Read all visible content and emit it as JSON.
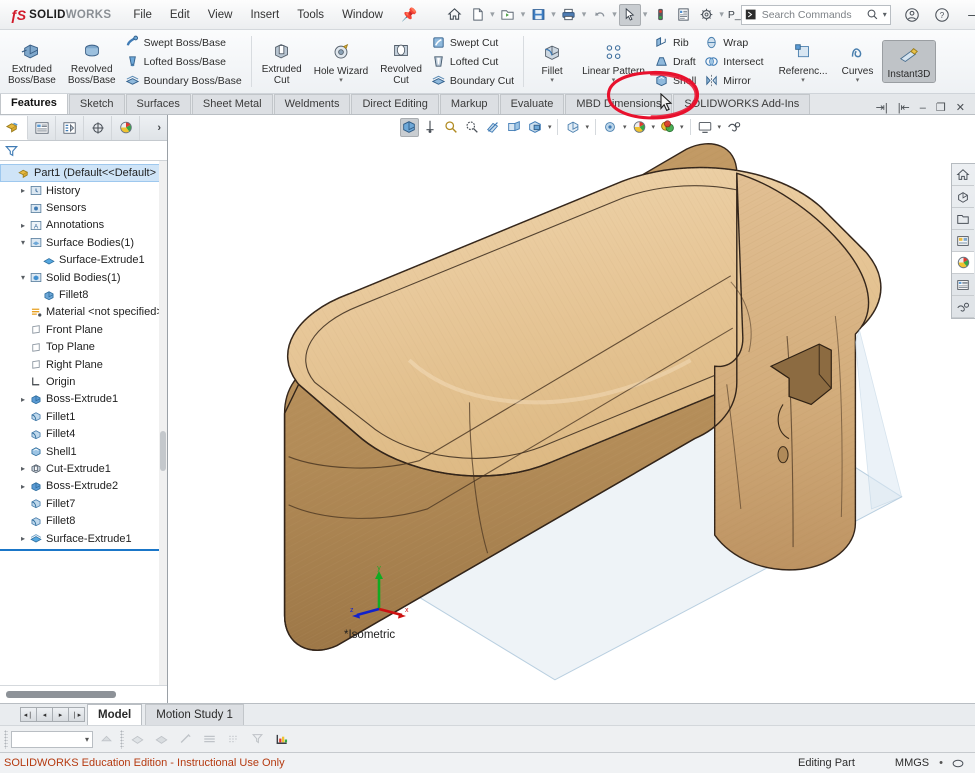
{
  "app": {
    "brand_dark": "SOLID",
    "brand_gray": "WORKS",
    "accent_red": "#d11a2a",
    "annotation_color": "#e8112d"
  },
  "menubar": {
    "items": [
      {
        "label": "File"
      },
      {
        "label": "Edit"
      },
      {
        "label": "View"
      },
      {
        "label": "Insert"
      },
      {
        "label": "Tools"
      },
      {
        "label": "Window"
      }
    ],
    "pin_icon": "pushpin-icon"
  },
  "quick_access": [
    {
      "name": "home-icon",
      "label": "Home"
    },
    {
      "name": "new-document-icon",
      "label": "New"
    },
    {
      "name": "open-folder-icon",
      "label": "Open"
    },
    {
      "name": "save-icon",
      "label": "Save"
    },
    {
      "name": "print-icon",
      "label": "Print"
    },
    {
      "name": "undo-icon",
      "label": "Undo"
    },
    {
      "name": "select-cursor-icon",
      "label": "Select"
    },
    {
      "name": "rebuild-icon",
      "label": "Rebuild"
    },
    {
      "name": "file-properties-icon",
      "label": "File Properties"
    },
    {
      "name": "options-gear-icon",
      "label": "Options"
    }
  ],
  "search": {
    "placeholder": "Search Commands",
    "icon": "search-icon",
    "dropdown_icon": "chevron-down-icon"
  },
  "window_controls": {
    "account": "account-icon",
    "help": "help-icon",
    "minimize": "minimize-icon",
    "maximize": "maximize-icon",
    "close": "close-icon"
  },
  "ribbon": {
    "boss_group": {
      "extruded": {
        "line1": "Extruded",
        "line2": "Boss/Base"
      },
      "revolved": {
        "line1": "Revolved",
        "line2": "Boss/Base"
      },
      "small": [
        {
          "label": "Swept Boss/Base",
          "icon": "swept-boss-icon"
        },
        {
          "label": "Lofted Boss/Base",
          "icon": "lofted-boss-icon"
        },
        {
          "label": "Boundary Boss/Base",
          "icon": "boundary-boss-icon"
        }
      ]
    },
    "cut_group": {
      "extruded_cut": {
        "line1": "Extruded",
        "line2": "Cut"
      },
      "hole_wizard": {
        "line1": "Hole Wizard",
        "line2": ""
      },
      "revolved_cut": {
        "line1": "Revolved",
        "line2": "Cut"
      },
      "small": [
        {
          "label": "Swept Cut",
          "icon": "swept-cut-icon"
        },
        {
          "label": "Lofted Cut",
          "icon": "lofted-cut-icon"
        },
        {
          "label": "Boundary Cut",
          "icon": "boundary-cut-icon"
        }
      ]
    },
    "feature_group": {
      "fillet": {
        "line1": "Fillet",
        "line2": ""
      },
      "linear_pattern": {
        "line1": "Linear Pattern",
        "line2": ""
      },
      "small_a": [
        {
          "label": "Rib",
          "icon": "rib-icon"
        },
        {
          "label": "Draft",
          "icon": "draft-icon"
        },
        {
          "label": "Shell",
          "icon": "shell-icon"
        }
      ],
      "small_b": [
        {
          "label": "Wrap",
          "icon": "wrap-icon"
        },
        {
          "label": "Intersect",
          "icon": "intersect-icon"
        },
        {
          "label": "Mirror",
          "icon": "mirror-icon"
        }
      ]
    },
    "right_group": {
      "reference": {
        "line1": "Referenc...",
        "line2": ""
      },
      "curves": {
        "line1": "Curves",
        "line2": ""
      },
      "instant3d": {
        "line1": "Instant3D",
        "line2": ""
      }
    },
    "annotation": {
      "target": "Intersect",
      "shape": "hand-drawn-ellipse"
    }
  },
  "ribbon_tabs": [
    {
      "label": "Features",
      "active": true
    },
    {
      "label": "Sketch",
      "active": false
    },
    {
      "label": "Surfaces",
      "active": false
    },
    {
      "label": "Sheet Metal",
      "active": false
    },
    {
      "label": "Weldments",
      "active": false
    },
    {
      "label": "Direct Editing",
      "active": false
    },
    {
      "label": "Markup",
      "active": false
    },
    {
      "label": "Evaluate",
      "active": false
    },
    {
      "label": "MBD Dimensions",
      "active": false
    },
    {
      "label": "SOLIDWORKS Add-Ins",
      "active": false
    }
  ],
  "document_window_controls": [
    {
      "name": "restore-left-icon"
    },
    {
      "name": "restore-right-icon"
    },
    {
      "name": "doc-minimize-icon"
    },
    {
      "name": "doc-restore-icon"
    },
    {
      "name": "doc-close-icon"
    }
  ],
  "manager_tabs": [
    {
      "name": "feature-manager-tab",
      "label": "FeatureManager Design Tree",
      "active": true
    },
    {
      "name": "property-manager-tab",
      "label": "PropertyManager",
      "active": false
    },
    {
      "name": "configuration-manager-tab",
      "label": "ConfigurationManager",
      "active": false
    },
    {
      "name": "dimxpert-manager-tab",
      "label": "DimXpertManager",
      "active": false
    },
    {
      "name": "display-manager-tab",
      "label": "DisplayManager",
      "active": false
    },
    {
      "name": "manager-expand",
      "label": "›",
      "active": false
    }
  ],
  "filter": {
    "icon": "filter-funnel-icon",
    "value": "",
    "placeholder": ""
  },
  "tree": {
    "items": [
      {
        "label": "Part1  (Default<<Default>",
        "indent": 0,
        "arrow": "",
        "icon": "part-icon",
        "selected": true
      },
      {
        "label": "History",
        "indent": 1,
        "arrow": "▸",
        "icon": "history-icon",
        "selected": false
      },
      {
        "label": "Sensors",
        "indent": 1,
        "arrow": "",
        "icon": "sensors-icon",
        "selected": false
      },
      {
        "label": "Annotations",
        "indent": 1,
        "arrow": "▸",
        "icon": "annotations-icon",
        "selected": false
      },
      {
        "label": "Surface Bodies(1)",
        "indent": 1,
        "arrow": "▾",
        "icon": "surface-bodies-icon",
        "selected": false
      },
      {
        "label": "Surface-Extrude1",
        "indent": 2,
        "arrow": "",
        "icon": "surface-body-icon",
        "selected": false
      },
      {
        "label": "Solid Bodies(1)",
        "indent": 1,
        "arrow": "▾",
        "icon": "solid-bodies-icon",
        "selected": false
      },
      {
        "label": "Fillet8",
        "indent": 2,
        "arrow": "",
        "icon": "solid-body-icon",
        "selected": false
      },
      {
        "label": "Material <not specified>",
        "indent": 1,
        "arrow": "",
        "icon": "material-icon",
        "selected": false
      },
      {
        "label": "Front Plane",
        "indent": 1,
        "arrow": "",
        "icon": "plane-icon",
        "selected": false
      },
      {
        "label": "Top Plane",
        "indent": 1,
        "arrow": "",
        "icon": "plane-icon",
        "selected": false
      },
      {
        "label": "Right Plane",
        "indent": 1,
        "arrow": "",
        "icon": "plane-icon",
        "selected": false
      },
      {
        "label": "Origin",
        "indent": 1,
        "arrow": "",
        "icon": "origin-icon",
        "selected": false
      },
      {
        "label": "Boss-Extrude1",
        "indent": 1,
        "arrow": "▸",
        "icon": "boss-extrude-icon",
        "selected": false
      },
      {
        "label": "Fillet1",
        "indent": 1,
        "arrow": "",
        "icon": "fillet-icon",
        "selected": false
      },
      {
        "label": "Fillet4",
        "indent": 1,
        "arrow": "",
        "icon": "fillet-icon",
        "selected": false
      },
      {
        "label": "Shell1",
        "indent": 1,
        "arrow": "",
        "icon": "shell-feature-icon",
        "selected": false
      },
      {
        "label": "Cut-Extrude1",
        "indent": 1,
        "arrow": "▸",
        "icon": "cut-extrude-icon",
        "selected": false
      },
      {
        "label": "Boss-Extrude2",
        "indent": 1,
        "arrow": "▸",
        "icon": "boss-extrude-icon",
        "selected": false
      },
      {
        "label": "Fillet7",
        "indent": 1,
        "arrow": "",
        "icon": "fillet-icon",
        "selected": false
      },
      {
        "label": "Fillet8",
        "indent": 1,
        "arrow": "",
        "icon": "fillet-icon",
        "selected": false
      },
      {
        "label": "Surface-Extrude1",
        "indent": 1,
        "arrow": "▸",
        "icon": "surface-extrude-icon",
        "selected": false
      }
    ]
  },
  "view_toolbar": [
    {
      "name": "zoom-to-fit-icon",
      "selected": true
    },
    {
      "name": "zoom-to-area-icon",
      "selected": false
    },
    {
      "name": "previous-view-icon",
      "selected": false
    },
    {
      "name": "section-view-icon",
      "selected": false
    },
    {
      "name": "view-orientation-icon",
      "selected": false
    },
    {
      "name": "display-style-icon",
      "selected": false
    },
    {
      "name": "hide-show-items-icon",
      "selected": false
    },
    {
      "name": "edit-appearance-icon",
      "selected": false
    },
    {
      "name": "apply-scene-icon",
      "selected": false
    },
    {
      "name": "view-settings-icon",
      "selected": false
    },
    {
      "name": "viewport-icon",
      "selected": false
    }
  ],
  "task_pane": [
    {
      "name": "solidworks-resources-icon"
    },
    {
      "name": "design-library-icon"
    },
    {
      "name": "file-explorer-icon"
    },
    {
      "name": "view-palette-icon"
    },
    {
      "name": "appearances-scenes-icon"
    },
    {
      "name": "custom-properties-icon"
    },
    {
      "name": "3d-content-central-icon"
    }
  ],
  "viewport": {
    "view_label": "*Isometric",
    "triad": {
      "x_label": "x",
      "y_label": "y",
      "z_label": "z",
      "x_color": "#cc1111",
      "y_color": "#11aa22",
      "z_color": "#1122cc"
    },
    "model": {
      "name": "wooden-rounded-box",
      "top_face_color": "#e7c89a",
      "side_face_color": "#c6a071",
      "dark_face_color": "#a9814f",
      "edge_color": "#3a2a18",
      "floor_plane_color": "#e9eef3"
    }
  },
  "bottom": {
    "nav": [
      {
        "name": "first-config-button",
        "glyph": "◂❘"
      },
      {
        "name": "prev-config-button",
        "glyph": "◂"
      },
      {
        "name": "next-config-button",
        "glyph": "▸"
      },
      {
        "name": "last-config-button",
        "glyph": "❘▸"
      }
    ],
    "tabs": [
      {
        "label": "Model",
        "active": true
      },
      {
        "label": "Motion Study 1",
        "active": false
      }
    ],
    "animation_toolbar": {
      "dropdown_value": "",
      "buttons": [
        {
          "name": "calculate-icon",
          "enabled": false
        },
        {
          "name": "playback-mode-icon",
          "enabled": false
        },
        {
          "name": "play-from-start-icon",
          "enabled": false
        },
        {
          "name": "play-icon",
          "enabled": false
        },
        {
          "name": "stop-icon",
          "enabled": false
        },
        {
          "name": "motion-study-properties-icon",
          "enabled": true
        }
      ]
    }
  },
  "status_bar": {
    "left": "SOLIDWORKS Education Edition - Instructional Use Only",
    "editing": "Editing Part",
    "units": "MMGS",
    "unit_caret": "•",
    "overlay_icon": "display-state-icon"
  }
}
